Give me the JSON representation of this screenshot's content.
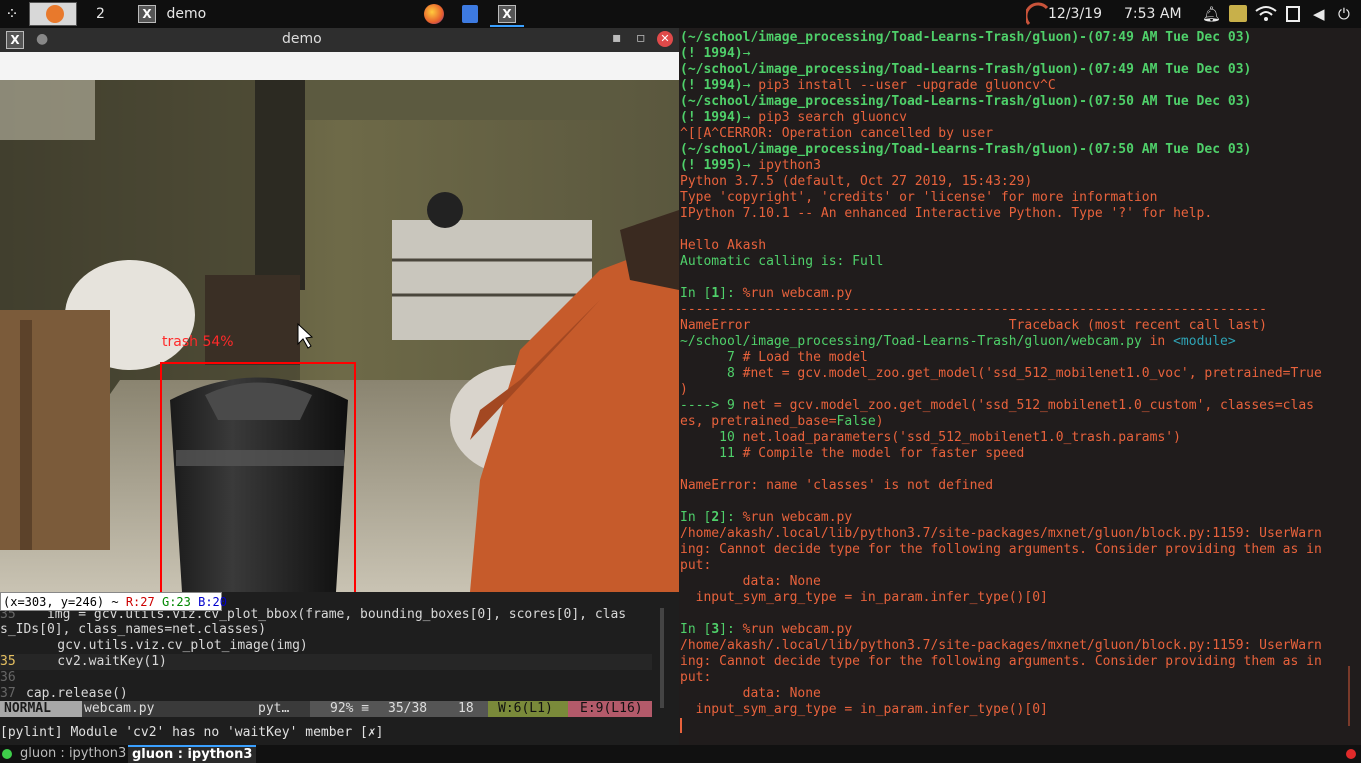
{
  "topbar": {
    "workspace_num": "2",
    "app_title": "demo",
    "date": "12/3/19",
    "time": "7:53 AM"
  },
  "demo_window": {
    "title": "demo",
    "detection_label": "trash 54%",
    "pixel_info": {
      "coords": "(x=303, y=246) ~",
      "r": "R:27",
      "g": "G:23",
      "b": "B:20"
    }
  },
  "vim": {
    "lines": [
      {
        "num": "35",
        "text": "    img = gcv.utils.viz.cv_plot_bbox(frame, bounding_boxes[0], scores[0], clas"
      },
      {
        "num": "",
        "text": "s_IDs[0], class_names=net.classes)"
      },
      {
        "num": "",
        "text": "    gcv.utils.viz.cv_plot_image(img)"
      },
      {
        "num": "35",
        "text": "    cv2.waitKey(1)"
      },
      {
        "num": "36",
        "text": ""
      },
      {
        "num": "37",
        "text": "cap.release()"
      }
    ],
    "mode": "NORMAL",
    "filename": "webcam.py",
    "filetype": "pyt…",
    "percent": "92% ≡",
    "position": "35/38",
    "column": "18",
    "warnings": "W:6(L1)",
    "errors": "E:9(L16)",
    "message": "[pylint] Module 'cv2' has no 'waitKey' member [✗]"
  },
  "terminal": {
    "lines": [
      [
        [
          "(~/school/image_processing/Toad-Learns-Trash/gluon)-(07:49 AM Tue Dec 03)",
          "gb"
        ]
      ],
      [
        [
          "(! 1994)",
          "gb"
        ],
        [
          "→",
          "g"
        ]
      ],
      [
        [
          "(~/school/image_processing/Toad-Learns-Trash/gluon)-(07:49 AM Tue Dec 03)",
          "gb"
        ]
      ],
      [
        [
          "(! 1994)",
          "gb"
        ],
        [
          "→ ",
          "g"
        ],
        [
          "pip3 install --user -upgrade gluoncv^C",
          "o"
        ]
      ],
      [
        [
          "(~/school/image_processing/Toad-Learns-Trash/gluon)-(07:50 AM Tue Dec 03)",
          "gb"
        ]
      ],
      [
        [
          "(! 1994)",
          "gb"
        ],
        [
          "→ ",
          "g"
        ],
        [
          "pip3 search gluoncv",
          "o"
        ]
      ],
      [
        [
          "^[[A^CERROR: Operation cancelled by user",
          "o"
        ]
      ],
      [
        [
          "(~/school/image_processing/Toad-Learns-Trash/gluon)-(07:50 AM Tue Dec 03)",
          "gb"
        ]
      ],
      [
        [
          "(! 1995)",
          "gb"
        ],
        [
          "→ ",
          "g"
        ],
        [
          "ipython3",
          "o"
        ]
      ],
      [
        [
          "Python 3.7.5 (default, Oct 27 2019, 15:43:29)",
          "o"
        ]
      ],
      [
        [
          "Type 'copyright', 'credits' or 'license' for more information",
          "o"
        ]
      ],
      [
        [
          "IPython 7.10.1 -- An enhanced Interactive Python. Type '?' for help.",
          "o"
        ]
      ],
      [
        [
          "",
          "o"
        ]
      ],
      [
        [
          "Hello Akash",
          "o"
        ]
      ],
      [
        [
          "Automatic calling is: Full",
          "g"
        ]
      ],
      [
        [
          "",
          "o"
        ]
      ],
      [
        [
          "In [",
          "g"
        ],
        [
          "1",
          "gb"
        ],
        [
          "]: ",
          "g"
        ],
        [
          "%run webcam.py",
          "o"
        ]
      ],
      [
        [
          "---------------------------------------------------------------------------",
          "o"
        ]
      ],
      [
        [
          "NameError                                 Traceback (most recent call last)",
          "o"
        ]
      ],
      [
        [
          "~/school/image_processing/Toad-Learns-Trash/gluon/webcam.py",
          "g"
        ],
        [
          " in ",
          "o"
        ],
        [
          "<module>",
          "c"
        ]
      ],
      [
        [
          "      7 ",
          "g"
        ],
        [
          "# Load the model",
          "o"
        ]
      ],
      [
        [
          "      8 ",
          "g"
        ],
        [
          "#net = gcv.model_zoo.get_model('ssd_512_mobilenet1.0_voc', pretrained=True",
          "o"
        ]
      ],
      [
        [
          ")",
          "o"
        ]
      ],
      [
        [
          "----> 9 ",
          "g"
        ],
        [
          "net = gcv.model_zoo.get_model('ssd_512_mobilenet1.0_custom', classes=clas",
          "o"
        ]
      ],
      [
        [
          "es, pretrained_base=",
          "o"
        ],
        [
          "False",
          "g"
        ],
        [
          ")",
          "o"
        ]
      ],
      [
        [
          "     10 ",
          "g"
        ],
        [
          "net.load_parameters('ssd_512_mobilenet1.0_trash.params')",
          "o"
        ]
      ],
      [
        [
          "     11 ",
          "g"
        ],
        [
          "# Compile the model for faster speed",
          "o"
        ]
      ],
      [
        [
          "",
          "o"
        ]
      ],
      [
        [
          "NameError",
          "o"
        ],
        [
          ": name 'classes' is not defined",
          "o"
        ]
      ],
      [
        [
          "",
          "o"
        ]
      ],
      [
        [
          "In [",
          "g"
        ],
        [
          "2",
          "gb"
        ],
        [
          "]: ",
          "g"
        ],
        [
          "%run webcam.py",
          "o"
        ]
      ],
      [
        [
          "/home/akash/.local/lib/python3.7/site-packages/mxnet/gluon/block.py:1159: UserWarn",
          "o"
        ]
      ],
      [
        [
          "ing: Cannot decide type for the following arguments. Consider providing them as in",
          "o"
        ]
      ],
      [
        [
          "put:",
          "o"
        ]
      ],
      [
        [
          "        data: None",
          "o"
        ]
      ],
      [
        [
          "  input_sym_arg_type = in_param.infer_type()[0]",
          "o"
        ]
      ],
      [
        [
          "",
          "o"
        ]
      ],
      [
        [
          "In [",
          "g"
        ],
        [
          "3",
          "gb"
        ],
        [
          "]: ",
          "g"
        ],
        [
          "%run webcam.py",
          "o"
        ]
      ],
      [
        [
          "/home/akash/.local/lib/python3.7/site-packages/mxnet/gluon/block.py:1159: UserWarn",
          "o"
        ]
      ],
      [
        [
          "ing: Cannot decide type for the following arguments. Consider providing them as in",
          "o"
        ]
      ],
      [
        [
          "put:",
          "o"
        ]
      ],
      [
        [
          "        data: None",
          "o"
        ]
      ],
      [
        [
          "  input_sym_arg_type = in_param.infer_type()[0]",
          "o"
        ]
      ]
    ]
  },
  "bottombar": {
    "tab1": "gluon : ipython3",
    "tab2": "gluon : ipython3"
  }
}
